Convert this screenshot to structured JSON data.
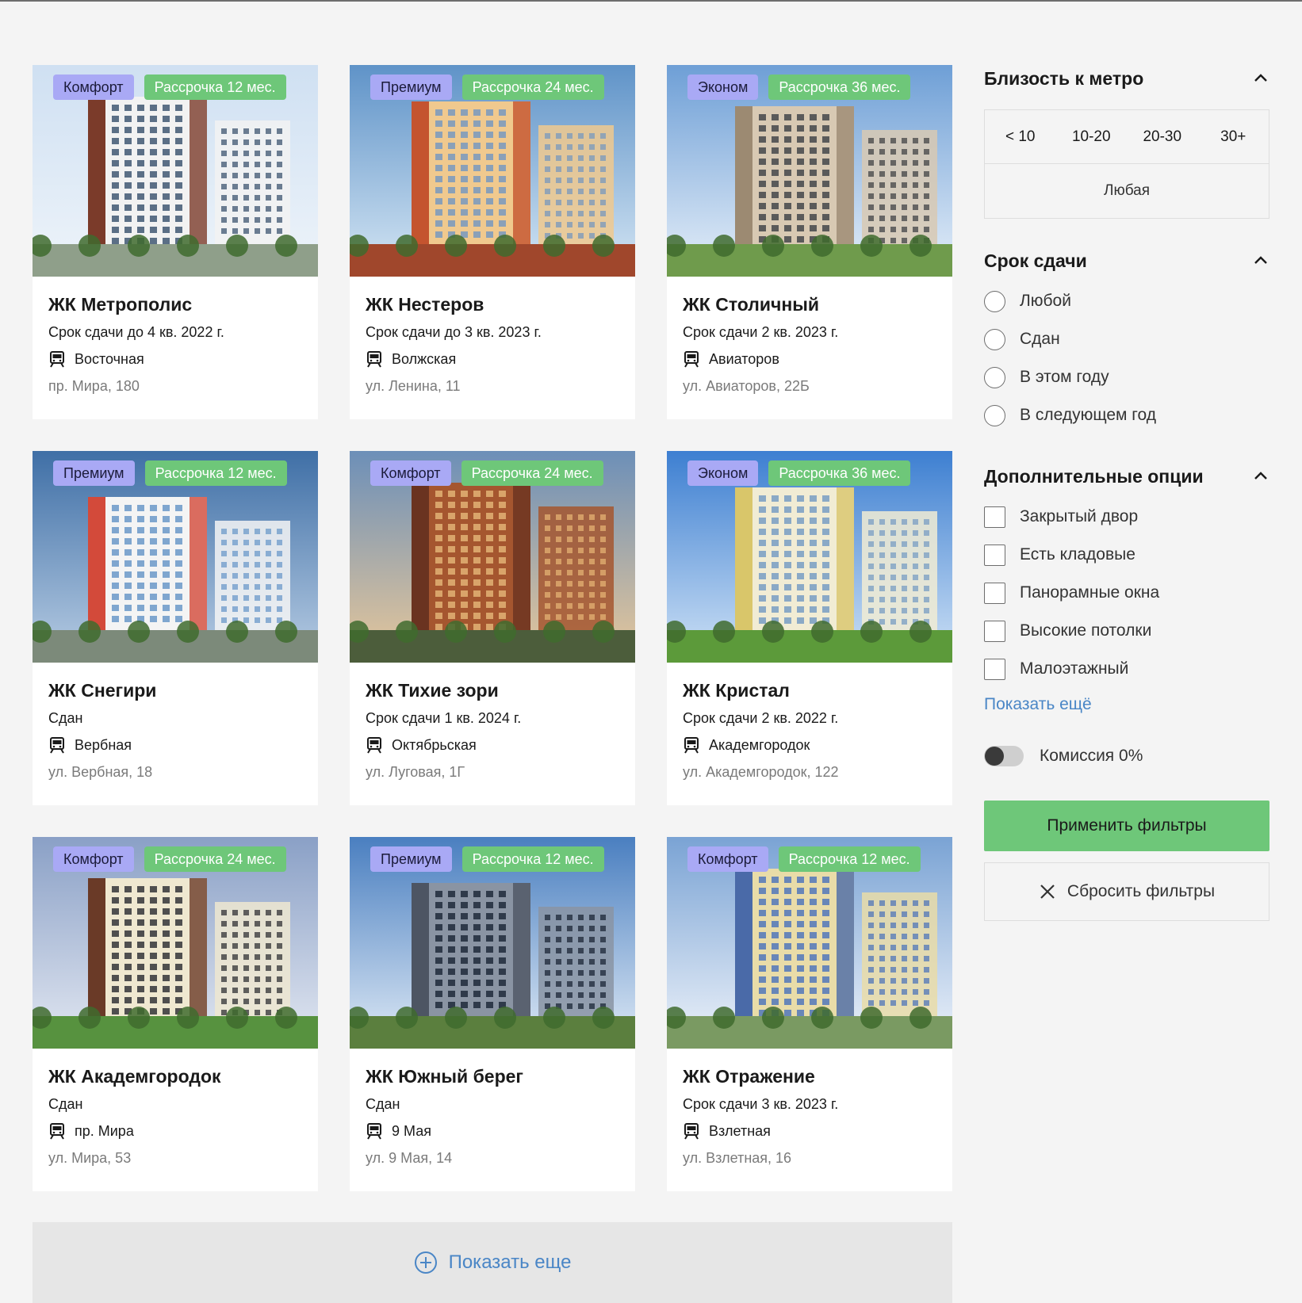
{
  "cards": [
    {
      "class": "Комфорт",
      "plan": "Рассрочка 12 мес.",
      "title": "ЖК Метрополис",
      "date": "Срок сдачи до 4 кв. 2022 г.",
      "metro": "Восточная",
      "address": "пр. Мира, 180",
      "photo": "building-photo"
    },
    {
      "class": "Премиум",
      "plan": "Рассрочка 24 мес.",
      "title": "ЖК Нестеров",
      "date": "Срок сдачи до 3 кв. 2023 г.",
      "metro": "Волжская",
      "address": "ул. Ленина, 11",
      "photo": "building-photo"
    },
    {
      "class": "Эконом",
      "plan": "Рассрочка 36 мес.",
      "title": "ЖК Столичный",
      "date": "Срок сдачи 2 кв. 2023 г.",
      "metro": "Авиаторов",
      "address": "ул. Авиаторов, 22Б",
      "photo": "building-photo"
    },
    {
      "class": "Премиум",
      "plan": "Рассрочка 12 мес.",
      "title": "ЖК Снегири",
      "date": "Сдан",
      "metro": "Вербная",
      "address": "ул. Вербная, 18",
      "photo": "building-photo"
    },
    {
      "class": "Комфорт",
      "plan": "Рассрочка 24 мес.",
      "title": "ЖК Тихие зори",
      "date": "Срок сдачи 1 кв. 2024 г.",
      "metro": "Октябрьская",
      "address": "ул. Луговая, 1Г",
      "photo": "building-photo"
    },
    {
      "class": "Эконом",
      "plan": "Рассрочка 36 мес.",
      "title": "ЖК Кристал",
      "date": "Срок сдачи 2 кв. 2022 г.",
      "metro": "Академгородок",
      "address": "ул. Академгородок, 122",
      "photo": "building-photo"
    },
    {
      "class": "Комфорт",
      "plan": "Рассрочка 24 мес.",
      "title": "ЖК Академгородок",
      "date": "Сдан",
      "metro": "пр. Мира",
      "address": "ул. Мира, 53",
      "photo": "building-photo"
    },
    {
      "class": "Премиум",
      "plan": "Рассрочка 12 мес.",
      "title": "ЖК Южный берег",
      "date": "Сдан",
      "metro": "9 Мая",
      "address": "ул. 9 Мая, 14",
      "photo": "building-photo"
    },
    {
      "class": "Комфорт",
      "plan": "Рассрочка 12 мес.",
      "title": "ЖК Отражение",
      "date": "Срок сдачи 3 кв. 2023 г.",
      "metro": "Взлетная",
      "address": "ул. Взлетная, 16",
      "photo": "building-photo"
    }
  ],
  "show_more": {
    "label": "Показать еще",
    "icon": "plus-circle-icon"
  },
  "filters": {
    "metro": {
      "title": "Близость к метро",
      "options": [
        "< 10",
        "10-20",
        "20-30",
        "30+"
      ],
      "any": "Любая"
    },
    "deadline": {
      "title": "Срок сдачи",
      "options": [
        "Любой",
        "Сдан",
        "В этом году",
        "В следующем год"
      ]
    },
    "extra": {
      "title": "Дополнительные опции",
      "options": [
        "Закрытый двор",
        "Есть кладовые",
        "Панорамные окна",
        "Высокие потолки",
        "Малоэтажный"
      ],
      "more_link": "Показать ещё"
    },
    "commission": {
      "label": "Комиссия 0%",
      "enabled": false
    },
    "apply_label": "Применить фильтры",
    "reset_label": "Сбросить фильтры"
  },
  "colors": {
    "class_badge": "#a9a9f5",
    "plan_badge": "#6ec779",
    "accent_link": "#4a86c6",
    "apply_button": "#6ec779"
  }
}
